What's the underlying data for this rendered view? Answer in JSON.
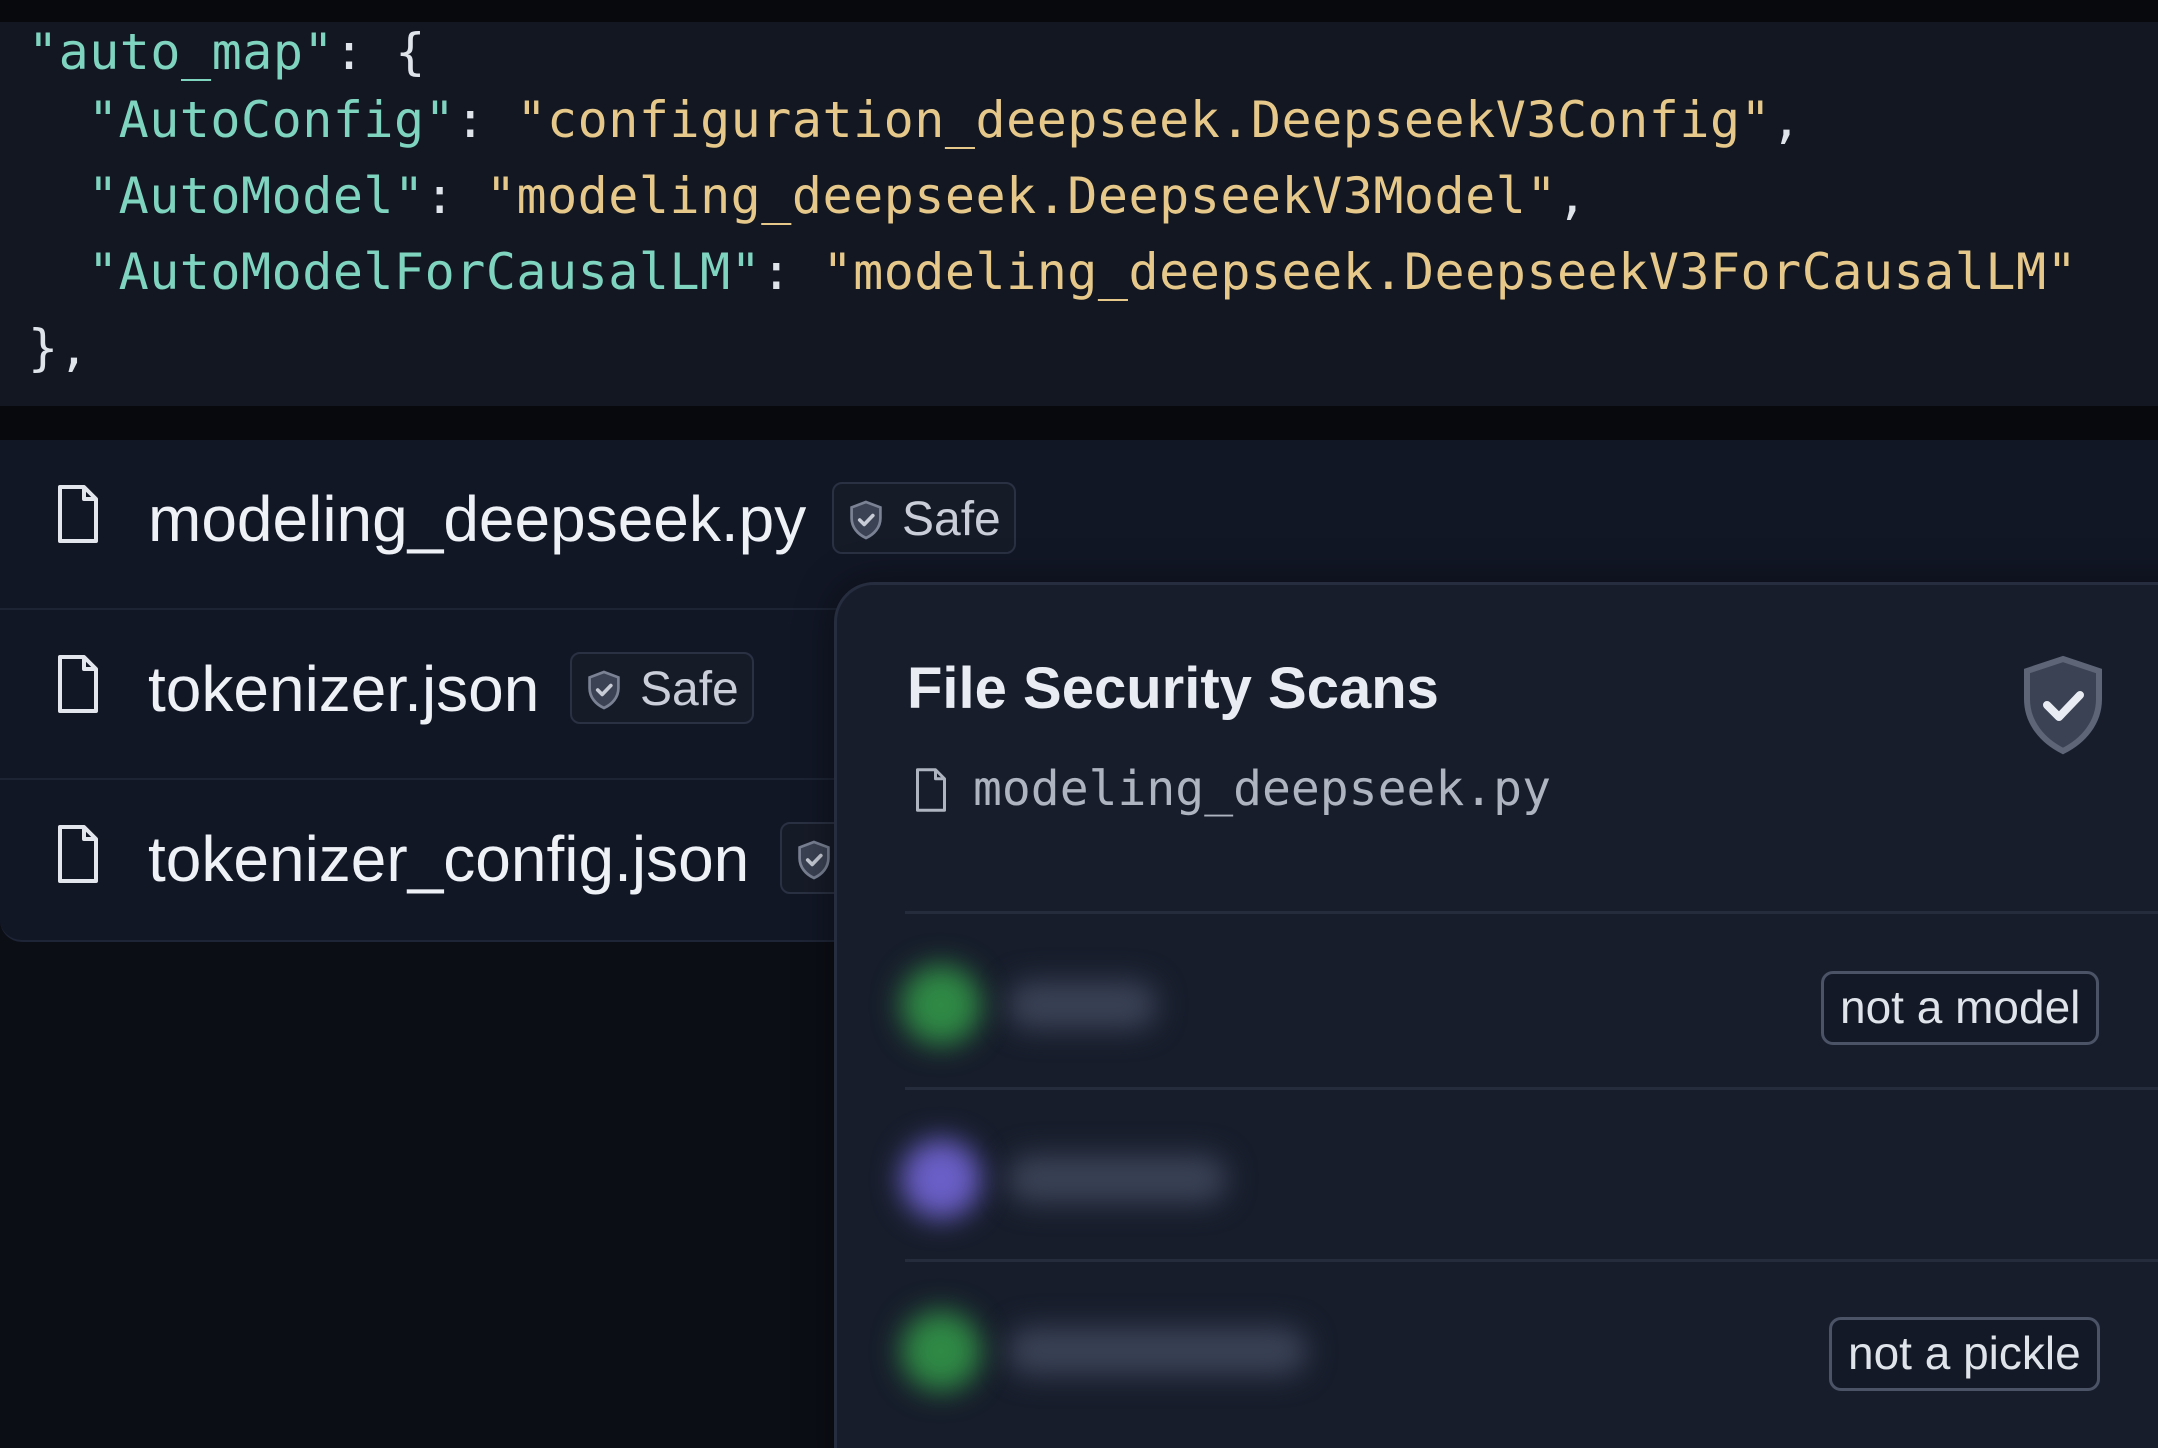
{
  "code": {
    "lines": [
      {
        "key": "\"auto_map\"",
        "sep": ": {",
        "value": "",
        "tail": ""
      },
      {
        "key": "\"AutoConfig\"",
        "sep": ": ",
        "value": "\"configuration_deepseek.DeepseekV3Config\"",
        "tail": ","
      },
      {
        "key": "\"AutoModel\"",
        "sep": ": ",
        "value": "\"modeling_deepseek.DeepseekV3Model\"",
        "tail": ","
      },
      {
        "key": "\"AutoModelForCausalLM\"",
        "sep": ": ",
        "value": "\"modeling_deepseek.DeepseekV3ForCausalLM\"",
        "tail": ""
      },
      {
        "key": "",
        "sep": "},",
        "value": "",
        "tail": ""
      }
    ]
  },
  "files": [
    {
      "name": "modeling_deepseek.py",
      "badge": "Safe"
    },
    {
      "name": "tokenizer.json",
      "badge": "Safe"
    },
    {
      "name": "tokenizer_config.json",
      "badge": ""
    }
  ],
  "popover": {
    "title": "File Security Scans",
    "filename": "modeling_deepseek.py",
    "scans": [
      {
        "dot_color": "#2f8a45",
        "status": "not a model"
      },
      {
        "dot_color": "#6a5fc7",
        "status": ""
      },
      {
        "dot_color": "#2f8a45",
        "status": "not a pickle"
      }
    ]
  },
  "icons": {
    "file": "file-icon",
    "shield": "shield-check-icon"
  }
}
